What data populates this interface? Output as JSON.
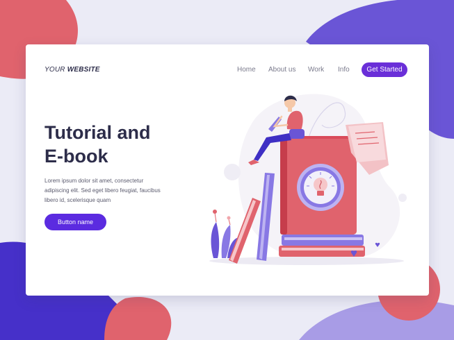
{
  "header": {
    "logo_prefix": "YOUR",
    "logo_suffix": "WEBSITE",
    "nav": {
      "home": "Home",
      "about": "About us",
      "work": "Work",
      "info": "Info"
    },
    "cta_label": "Get Started"
  },
  "hero": {
    "title_line1": "Tutorial and",
    "title_line2": "E-book",
    "description": [
      "Lorem ipsum dolor sit amet, consectetur",
      "adipiscing elit. Sed eget libero feugiat, faucibus",
      "libero id, scelerisque quam"
    ],
    "button_label": "Button name"
  },
  "colors": {
    "background": "#ebebf6",
    "accent_purple": "#5b2be0",
    "blob_coral": "#e0636d",
    "blob_purple": "#6a55d6",
    "title_text": "#2d2d4a"
  },
  "illustration": {
    "icons": [
      "person-reading-icon",
      "book-stack-icon",
      "lightbulb-icon",
      "paper-sheet-icon",
      "plant-icon"
    ]
  }
}
